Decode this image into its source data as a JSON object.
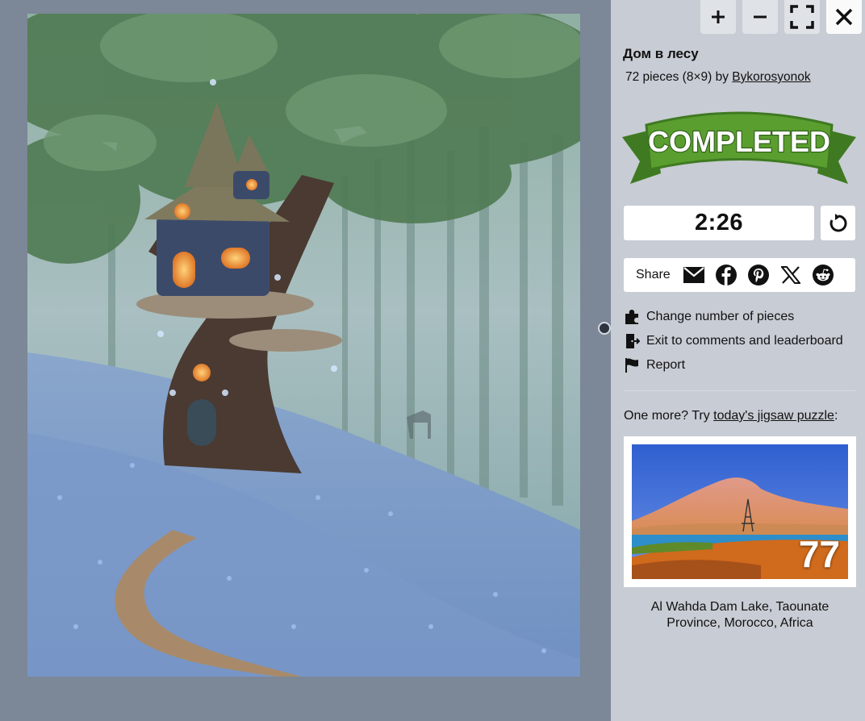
{
  "toolbar": {
    "zoom_in_icon": "plus-icon",
    "zoom_out_icon": "minus-icon",
    "fullscreen_icon": "fullscreen-icon",
    "close_icon": "close-icon"
  },
  "puzzle": {
    "title": "Дом в лесу",
    "pieces_text": "72 pieces (8×9) by",
    "author": "Bykorosyonok"
  },
  "banner": {
    "text": "COMPLETED",
    "color_green": "#5a9e2f"
  },
  "timer": {
    "value": "2:26",
    "restart_icon": "restart-icon"
  },
  "share": {
    "label": "Share",
    "icons": [
      "email-icon",
      "facebook-icon",
      "pinterest-icon",
      "x-icon",
      "reddit-icon"
    ]
  },
  "menu": {
    "change_pieces": "Change number of pieces",
    "exit_comments": "Exit to comments and leaderboard",
    "report": "Report"
  },
  "daily": {
    "prefix": "One more? Try",
    "link": "today's jigsaw puzzle",
    "suffix": ":",
    "count": "77",
    "caption": "Al Wahda Dam Lake, Taounate Province, Morocco, Africa"
  }
}
